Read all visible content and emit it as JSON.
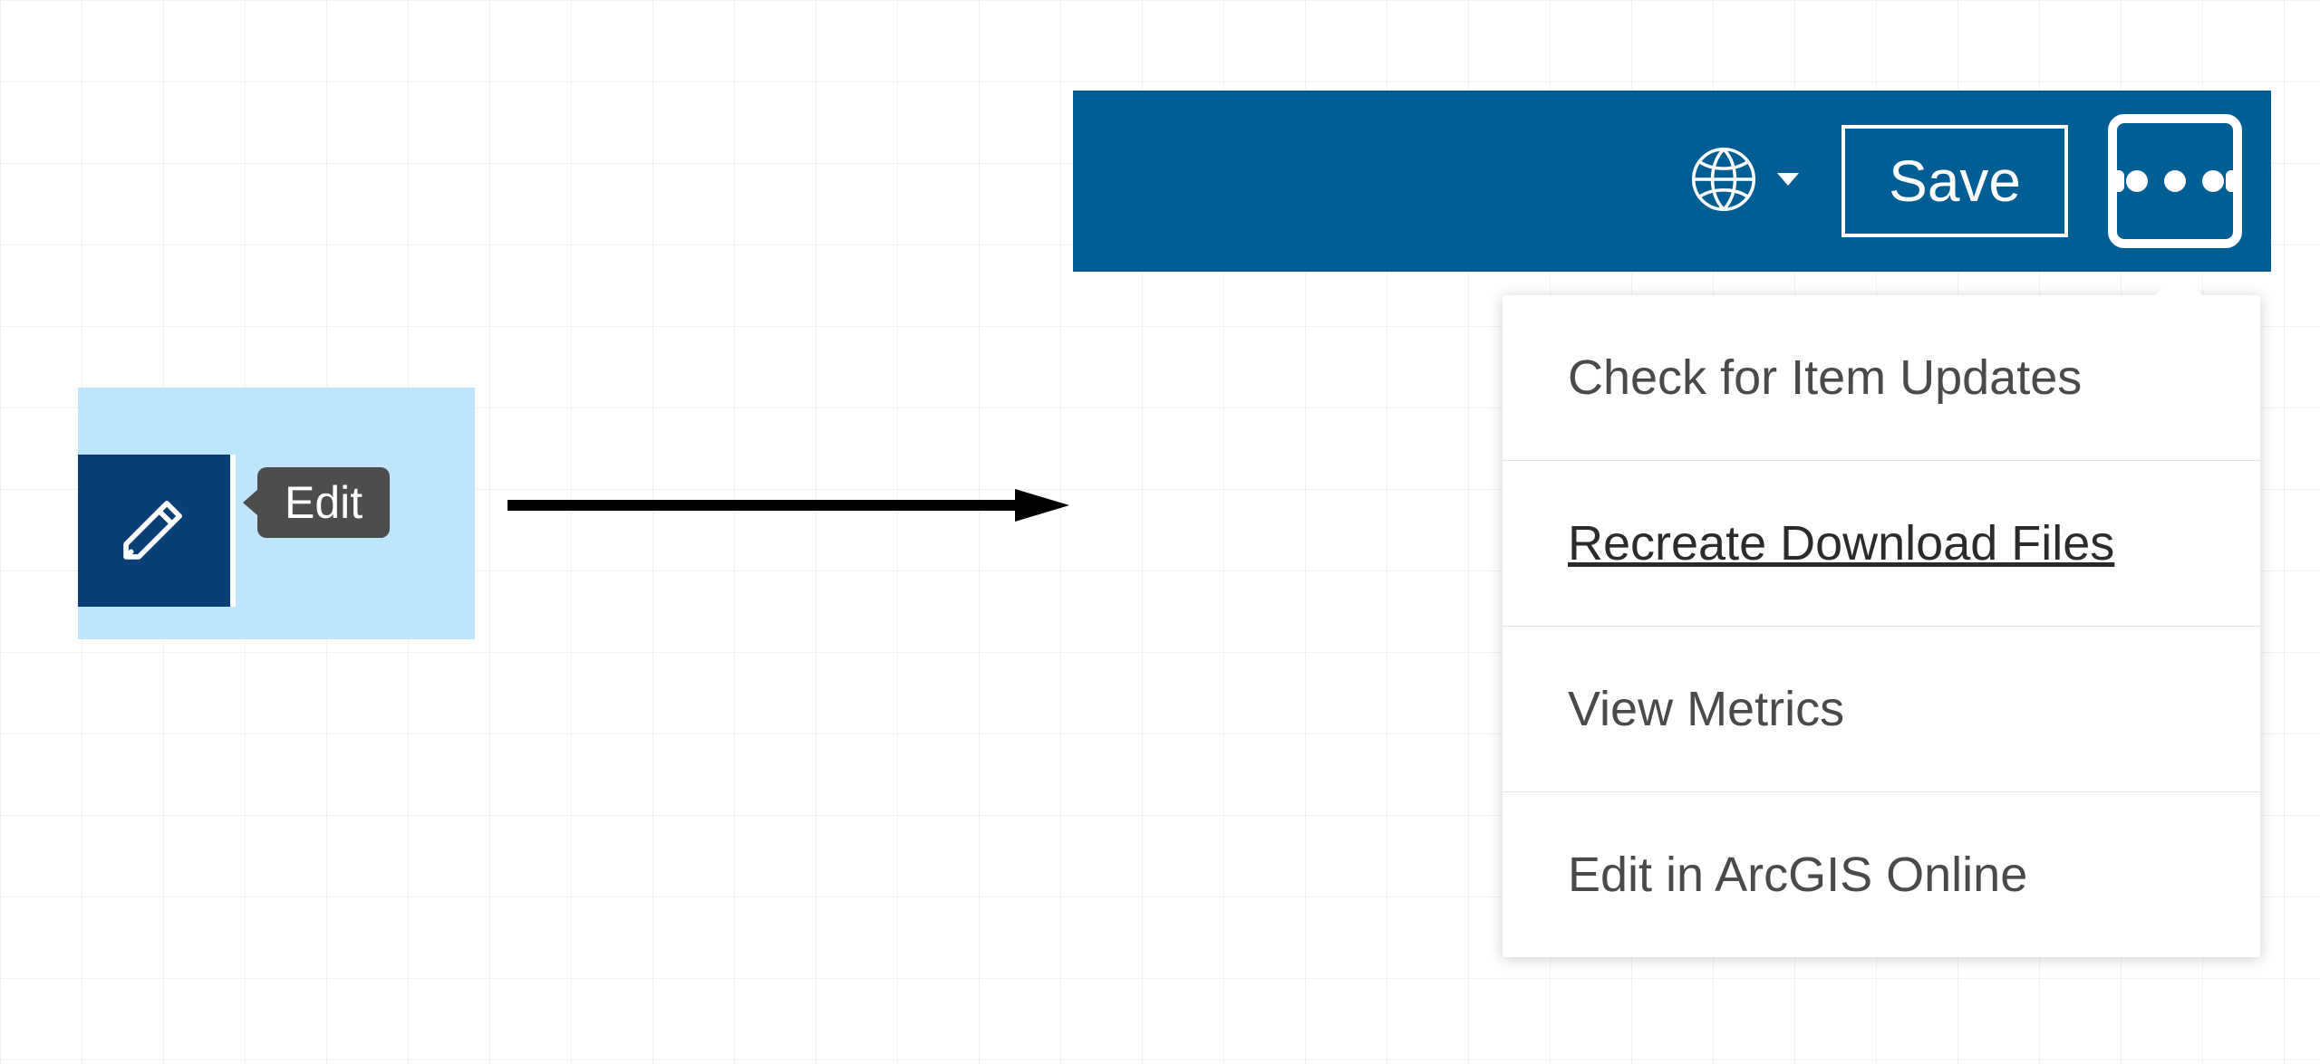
{
  "edit": {
    "tooltip": "Edit"
  },
  "topbar": {
    "save_label": "Save"
  },
  "dropdown": {
    "items": [
      {
        "label": "Check for Item Updates",
        "highlight": false
      },
      {
        "label": "Recreate Download Files",
        "highlight": true
      },
      {
        "label": "View Metrics",
        "highlight": false
      },
      {
        "label": "Edit in ArcGIS Online",
        "highlight": false
      }
    ]
  }
}
